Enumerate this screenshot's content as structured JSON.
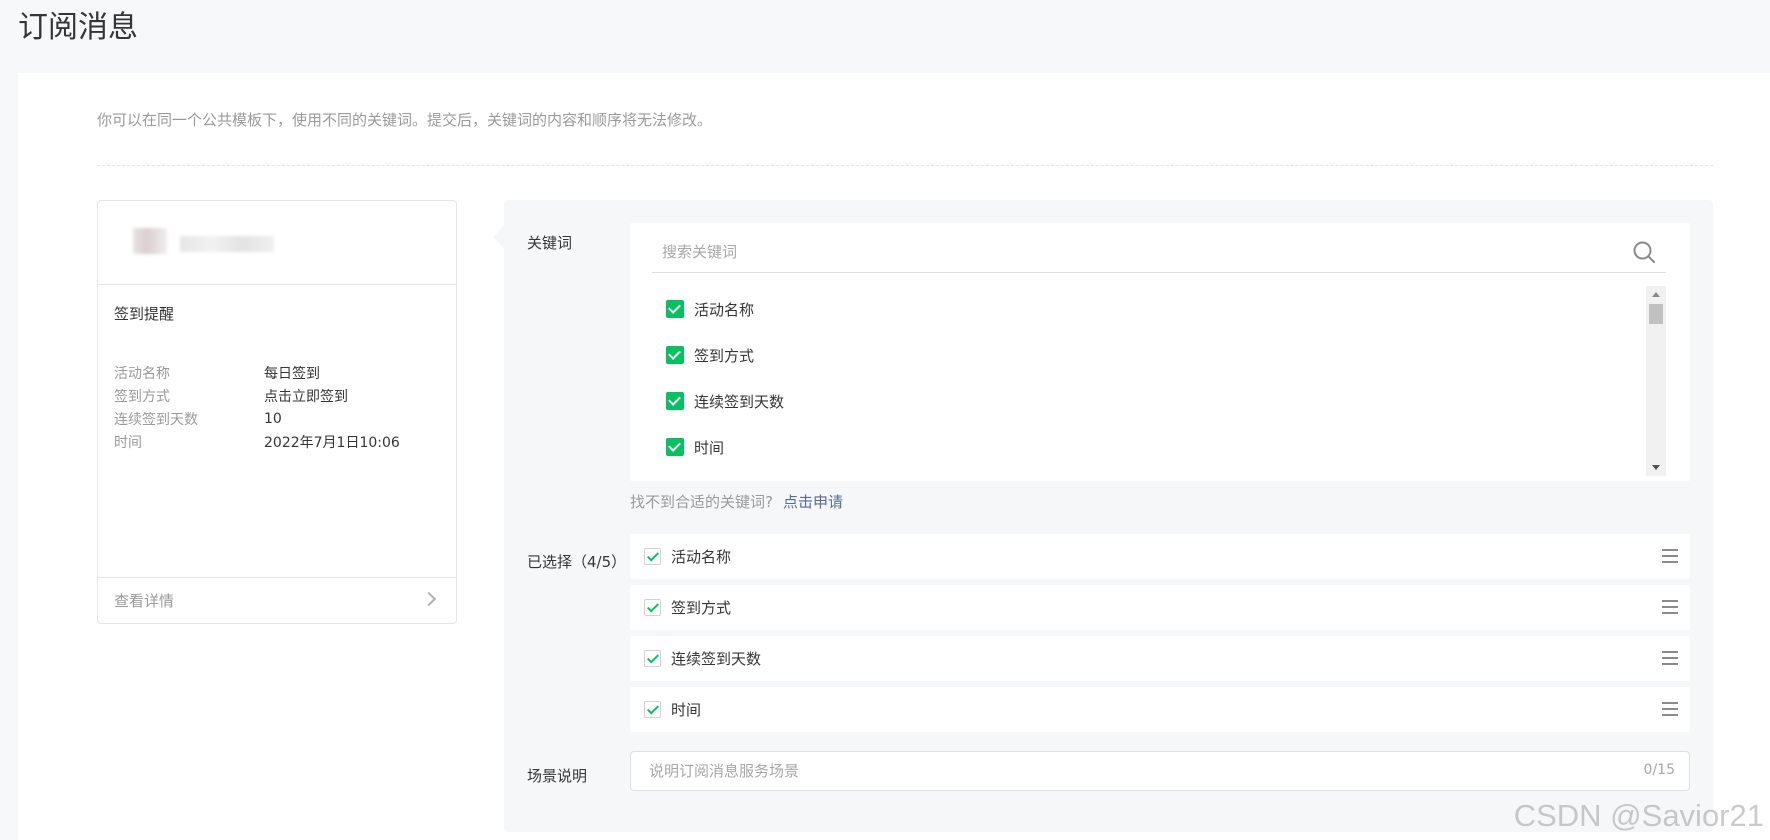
{
  "page": {
    "title": "订阅消息"
  },
  "tip": "你可以在同一个公共模板下，使用不同的关键词。提交后，关键词的内容和顺序将无法修改。",
  "preview": {
    "title": "签到提醒",
    "fields": [
      {
        "label": "活动名称",
        "value": "每日签到"
      },
      {
        "label": "签到方式",
        "value": "点击立即签到"
      },
      {
        "label": "连续签到天数",
        "value": "10"
      },
      {
        "label": "时间",
        "value": "2022年7月1日10:06"
      }
    ],
    "detail_link": "查看详情"
  },
  "keywords": {
    "label": "关键词",
    "search_placeholder": "搜索关键词",
    "items": [
      {
        "label": "活动名称",
        "checked": true
      },
      {
        "label": "签到方式",
        "checked": true
      },
      {
        "label": "连续签到天数",
        "checked": true
      },
      {
        "label": "时间",
        "checked": true
      }
    ],
    "hint": "找不到合适的关键词?",
    "hint_link": "点击申请"
  },
  "selected": {
    "label": "已选择（4/5）",
    "items": [
      "活动名称",
      "签到方式",
      "连续签到天数",
      "时间"
    ]
  },
  "scene": {
    "label": "场景说明",
    "placeholder": "说明订阅消息服务场景",
    "counter": "0/15"
  },
  "watermark": "CSDN @Savior21",
  "colors": {
    "accent_green": "#07c160",
    "link_blue": "#576b95"
  }
}
